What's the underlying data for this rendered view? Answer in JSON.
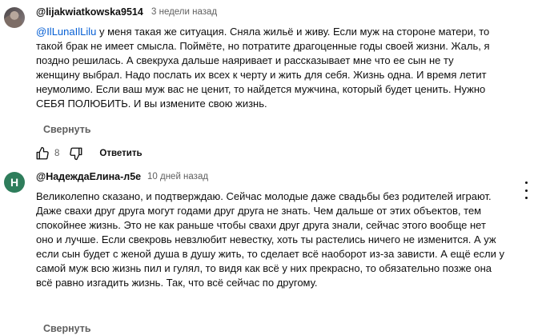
{
  "comments": [
    {
      "author": "@lijakwiatkowska9514",
      "time": "3 недели назад",
      "mention": "@IlLunaIlLilu",
      "text": "у меня такая же ситуация. Сняла жильё и живу. Если муж на стороне матери, то такой брак не имеет смысла. Поймёте, но потратите драгоценные годы своей жизни. Жаль, я поздно решилась. А свекруха дальше наяривает и рассказывает мне что ее сын не ту женщину выбрал. Надо послать их всех к черту и жить для себя. Жизнь одна. И время летит неумолимо. Если ваш муж вас не ценит, то найдется мужчина, который будет ценить. Нужно СЕБЯ ПОЛЮБИТЬ. И вы измените свою жизнь.",
      "collapse_label": "Свернуть",
      "like_count": "8",
      "reply_label": "Ответить",
      "like_icon": "thumb-up-icon",
      "dislike_icon": "thumb-down-icon"
    },
    {
      "author": "@НадеждаЕлина-л5е",
      "time": "10 дней назад",
      "avatar_letter": "Н",
      "avatar_color": "#2e7d5b",
      "text": "Великолепно сказано, и подтверждаю. Сейчас молодые даже свадьбы без родителей играют. Даже свахи друг друга могут годами друг друга не знать. Чем дальше от этих объектов, тем спокойнее жизнь. Это не как раньше чтобы свахи друг друга знали, сейчас этого вообще нет оно и лучше. Если свекровь невзлюбит невестку, хоть ты растелись ничего  не изменится. А уж если сын будет с женой душа в душу жить, то сделает всё наоборот из-за зависти. А ещё если у самой муж всю жизнь пил и гулял, то видя как всё у них прекрасно, то обязательно позже она всё равно изгадить жизнь. Так, что всё сейчас по другому.",
      "collapse_label": "Свернуть",
      "menu_icon": "more-vert-icon"
    }
  ],
  "colors": {
    "mention": "#065fd4",
    "secondary_text": "#606060",
    "primary_text": "#0f0f0f"
  }
}
